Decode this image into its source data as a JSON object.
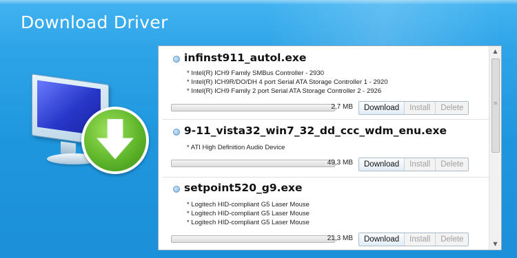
{
  "window": {
    "title": "Download Driver"
  },
  "illustration": {
    "icons": [
      "monitor-icon",
      "download-arrow-icon"
    ],
    "accent_green": "#5fb62b"
  },
  "drivers": [
    {
      "filename": "infinst911_autol.exe",
      "devices": [
        "* Intel(R) ICH9 Family SMBus Controller - 2930",
        "* Intel(R) ICH9R/DO/DH 4 port Serial ATA Storage Controller 1 - 2920",
        "* Intel(R) ICH9 Family 2 port Serial ATA Storage Controller 2 - 2926"
      ],
      "size": "2,7 MB",
      "progress": 0,
      "download_label": "Download",
      "install_label": "Install",
      "delete_label": "Delete"
    },
    {
      "filename": "9-11_vista32_win7_32_dd_ccc_wdm_enu.exe",
      "devices": [
        "* ATI High Definition Audio Device"
      ],
      "size": "49,3 MB",
      "progress": 0,
      "download_label": "Download",
      "install_label": "Install",
      "delete_label": "Delete"
    },
    {
      "filename": "setpoint520_g9.exe",
      "devices": [
        "* Logitech HID-compliant G5 Laser Mouse",
        "* Logitech HID-compliant G5 Laser Mouse",
        "* Logitech HID-compliant G5 Laser Mouse"
      ],
      "size": "21,3 MB",
      "progress": 0,
      "download_label": "Download",
      "install_label": "Install",
      "delete_label": "Delete"
    }
  ],
  "colors": {
    "background": "#1e96de",
    "button_disabled_text": "#a0a0a0"
  }
}
